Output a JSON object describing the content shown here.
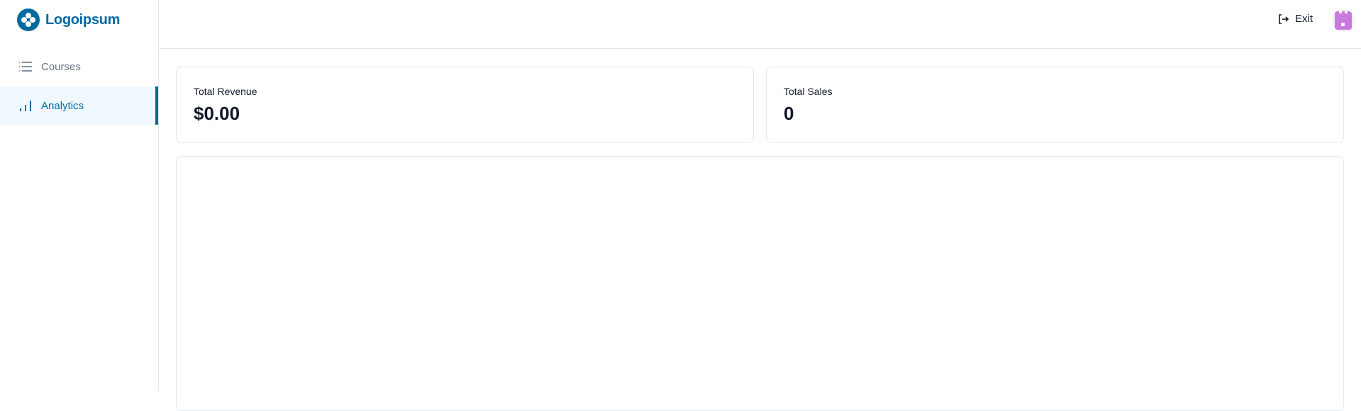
{
  "brand": {
    "name": "Logoipsum",
    "color": "#0369a1"
  },
  "sidebar": {
    "items": [
      {
        "label": "Courses",
        "icon": "list-icon",
        "active": false
      },
      {
        "label": "Analytics",
        "icon": "bar-chart-icon",
        "active": true
      }
    ]
  },
  "header": {
    "exit_label": "Exit",
    "exit_icon": "log-out-icon"
  },
  "stats": {
    "revenue": {
      "label": "Total Revenue",
      "value": "$0.00"
    },
    "sales": {
      "label": "Total Sales",
      "value": "0"
    }
  }
}
